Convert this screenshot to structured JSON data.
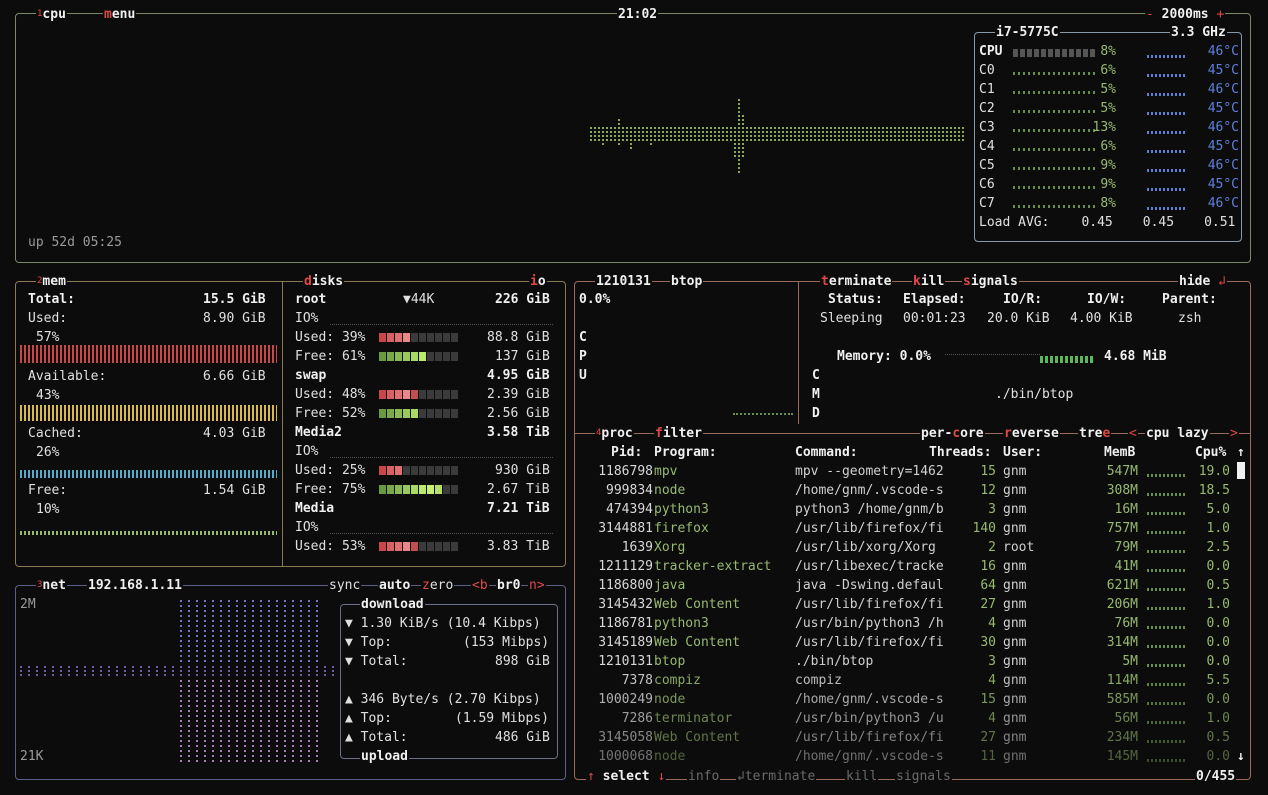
{
  "cpu_box": {
    "tab_label": "cpu",
    "tab_num": "1",
    "menu_label": "enu",
    "menu_hot": "m",
    "clock": "21:02",
    "interval_minus": "-",
    "interval": "2000ms",
    "interval_plus": "+",
    "uptime": "up 52d 05:25",
    "cpu_model": "i7-5775C",
    "cpu_freq": "3.3 GHz",
    "cores": [
      {
        "name": "CPU",
        "pct": "8%",
        "temp": "46°C"
      },
      {
        "name": "C0",
        "pct": "6%",
        "temp": "45°C"
      },
      {
        "name": "C1",
        "pct": "5%",
        "temp": "46°C"
      },
      {
        "name": "C2",
        "pct": "5%",
        "temp": "45°C"
      },
      {
        "name": "C3",
        "pct": "13%",
        "temp": "46°C"
      },
      {
        "name": "C4",
        "pct": "6%",
        "temp": "45°C"
      },
      {
        "name": "C5",
        "pct": "9%",
        "temp": "46°C"
      },
      {
        "name": "C6",
        "pct": "9%",
        "temp": "45°C"
      },
      {
        "name": "C7",
        "pct": "8%",
        "temp": "46°C"
      }
    ],
    "load_label": "Load AVG:",
    "load": [
      "0.45",
      "0.45",
      "0.51"
    ]
  },
  "mem_box": {
    "tab_num": "2",
    "tab_label": "mem",
    "total_label": "Total:",
    "total": "15.5 GiB",
    "used_label": "Used:",
    "used": "8.90 GiB",
    "used_pct": "57%",
    "available_label": "Available:",
    "available": "6.66 GiB",
    "available_pct": "43%",
    "cached_label": "Cached:",
    "cached": "4.03 GiB",
    "cached_pct": "26%",
    "free_label": "Free:",
    "free": "1.54 GiB",
    "free_pct": "10%"
  },
  "disks_box": {
    "hot": "d",
    "label": "isks",
    "io_hot": "i",
    "io_label": "o",
    "root_name": "root",
    "root_io": "▼44K",
    "root_size": "226 GiB",
    "root_io_label": "IO%",
    "root_used": "Used: 39%",
    "root_used_val": "88.8 GiB",
    "root_free": "Free: 61%",
    "root_free_val": "137 GiB",
    "swap_name": "swap",
    "swap_size": "4.95 GiB",
    "swap_used": "Used: 48%",
    "swap_used_val": "2.39 GiB",
    "swap_free": "Free: 52%",
    "swap_free_val": "2.56 GiB",
    "media2_name": "Media2",
    "media2_size": "3.58 TiB",
    "media2_io_label": "IO%",
    "media2_used": "Used: 25%",
    "media2_used_val": "930 GiB",
    "media2_free": "Free: 75%",
    "media2_free_val": "2.67 TiB",
    "media_name": "Media",
    "media_size": "7.21 TiB",
    "media_io_label": "IO%",
    "media_used": "Used: 53%",
    "media_used_val": "3.83 TiB"
  },
  "net_box": {
    "tab_num": "3",
    "tab_label": "net",
    "ip": "192.168.1.11",
    "sync": "sync",
    "auto": "auto",
    "zero_hot": "z",
    "zero": "ero",
    "iface_prev": "<b",
    "iface": "br0",
    "iface_next": "n>",
    "scale_top": "2M",
    "scale_bottom": "21K",
    "download_label": "download",
    "dl_rate": "1.30 KiB/s",
    "dl_rate_bits": "(10.4 Kibps)",
    "dl_top_label": "Top:",
    "dl_top": "(153 Mibps)",
    "dl_total_label": "Total:",
    "dl_total": "898 GiB",
    "ul_rate": "346 Byte/s",
    "ul_rate_bits": "(2.70 Kibps)",
    "ul_top_label": "Top:",
    "ul_top": "(1.59 Mibps)",
    "ul_total_label": "Total:",
    "ul_total": "486 GiB",
    "upload_label": "upload"
  },
  "info_box": {
    "pid": "1210131",
    "name": "btop",
    "cpu_pct": "0.0%",
    "cpu_letters": [
      "C",
      "P",
      "U"
    ],
    "terminate_hot": "t",
    "terminate": "erminate",
    "kill_hot": "k",
    "kill": "ill",
    "signals_hot": "s",
    "signals": "ignals",
    "hide": "hide",
    "headers": [
      "Status:",
      "Elapsed:",
      "IO/R:",
      "IO/W:",
      "Parent:"
    ],
    "values": [
      "Sleeping",
      "00:01:23",
      "20.0 KiB",
      "4.00 KiB",
      "zsh"
    ],
    "memory_label": "Memory: 0.0%",
    "memory_val": "4.68 MiB",
    "mem_letters": [
      "C",
      "M",
      "D"
    ],
    "cmd": "./bin/btop"
  },
  "proc_box": {
    "tab_num": "4",
    "tab_label": "proc",
    "filter_hot": "f",
    "filter": "ilter",
    "per_core": "per-",
    "per_core_hot": "c",
    "per_core_rest": "ore",
    "reverse_hot": "r",
    "reverse": "everse",
    "tree": "tre",
    "tree_hot": "e",
    "sort_prev": "<",
    "sort": "cpu lazy",
    "sort_next": ">",
    "headers": {
      "pid": "Pid:",
      "program": "Program:",
      "command": "Command:",
      "threads": "Threads:",
      "user": "User:",
      "memb": "MemB",
      "cpu": "Cpu%"
    },
    "rows": [
      {
        "pid": "1186798",
        "program": "mpv",
        "command": "mpv --geometry=1462",
        "threads": "15",
        "user": "gnm",
        "mem": "547M",
        "cpu": "19.0"
      },
      {
        "pid": "999834",
        "program": "node",
        "command": "/home/gnm/.vscode-s",
        "threads": "12",
        "user": "gnm",
        "mem": "308M",
        "cpu": "18.5"
      },
      {
        "pid": "474394",
        "program": "python3",
        "command": "python3 /home/gnm/b",
        "threads": "3",
        "user": "gnm",
        "mem": "16M",
        "cpu": "5.0"
      },
      {
        "pid": "3144881",
        "program": "firefox",
        "command": "/usr/lib/firefox/fi",
        "threads": "140",
        "user": "gnm",
        "mem": "757M",
        "cpu": "1.0"
      },
      {
        "pid": "1639",
        "program": "Xorg",
        "command": "/usr/lib/xorg/Xorg",
        "threads": "2",
        "user": "root",
        "mem": "79M",
        "cpu": "2.5"
      },
      {
        "pid": "1211129",
        "program": "tracker-extract",
        "command": "/usr/libexec/tracke",
        "threads": "16",
        "user": "gnm",
        "mem": "41M",
        "cpu": "0.0"
      },
      {
        "pid": "1186800",
        "program": "java",
        "command": "java -Dswing.defaul",
        "threads": "64",
        "user": "gnm",
        "mem": "621M",
        "cpu": "0.5"
      },
      {
        "pid": "3145432",
        "program": "Web Content",
        "command": "/usr/lib/firefox/fi",
        "threads": "27",
        "user": "gnm",
        "mem": "206M",
        "cpu": "1.0"
      },
      {
        "pid": "1186781",
        "program": "python3",
        "command": "/usr/bin/python3 /h",
        "threads": "4",
        "user": "gnm",
        "mem": "76M",
        "cpu": "0.0"
      },
      {
        "pid": "3145189",
        "program": "Web Content",
        "command": "/usr/lib/firefox/fi",
        "threads": "30",
        "user": "gnm",
        "mem": "314M",
        "cpu": "0.0"
      },
      {
        "pid": "1210131",
        "program": "btop",
        "command": "./bin/btop",
        "threads": "3",
        "user": "gnm",
        "mem": "5M",
        "cpu": "0.0"
      },
      {
        "pid": "7378",
        "program": "compiz",
        "command": "compiz",
        "threads": "4",
        "user": "gnm",
        "mem": "114M",
        "cpu": "5.5"
      },
      {
        "pid": "1000249",
        "program": "node",
        "command": "/home/gnm/.vscode-s",
        "threads": "15",
        "user": "gnm",
        "mem": "585M",
        "cpu": "0.0"
      },
      {
        "pid": "7286",
        "program": "terminator",
        "command": "/usr/bin/python3 /u",
        "threads": "4",
        "user": "gnm",
        "mem": "56M",
        "cpu": "1.0"
      },
      {
        "pid": "3145058",
        "program": "Web Content",
        "command": "/usr/lib/firefox/fi",
        "threads": "27",
        "user": "gnm",
        "mem": "234M",
        "cpu": "0.5"
      },
      {
        "pid": "1000068",
        "program": "node",
        "command": "/home/gnm/.vscode-s",
        "threads": "11",
        "user": "gnm",
        "mem": "145M",
        "cpu": "0.0"
      }
    ],
    "footer_select": "select",
    "footer_info": "info",
    "footer_terminate": "terminate",
    "footer_kill": "kill",
    "footer_signals": "signals",
    "count": "0/455",
    "scroll_up": "↑",
    "scroll_down": "↓",
    "select_up": "↑",
    "select_down": "↓",
    "enter_glyph": "↲"
  }
}
